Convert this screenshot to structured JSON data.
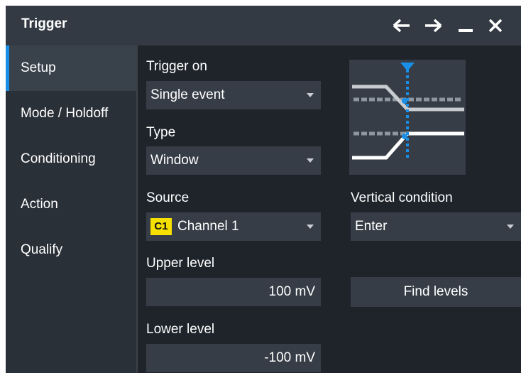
{
  "window": {
    "title": "Trigger",
    "icons": [
      "arrow-left-icon",
      "arrow-right-icon",
      "minimize-icon",
      "close-icon"
    ]
  },
  "sidebar": {
    "items": [
      {
        "label": "Setup",
        "active": true
      },
      {
        "label": "Mode / Holdoff",
        "active": false
      },
      {
        "label": "Conditioning",
        "active": false
      },
      {
        "label": "Action",
        "active": false
      },
      {
        "label": "Qualify",
        "active": false
      }
    ]
  },
  "form": {
    "trigger_on": {
      "label": "Trigger on",
      "value": "Single event"
    },
    "type": {
      "label": "Type",
      "value": "Window"
    },
    "source": {
      "label": "Source",
      "badge": "C1",
      "value": "Channel 1"
    },
    "vertical_condition": {
      "label": "Vertical condition",
      "value": "Enter"
    },
    "upper_level": {
      "label": "Upper level",
      "value": "100 mV"
    },
    "lower_level": {
      "label": "Lower level",
      "value": "-100 mV"
    },
    "find_levels_label": "Find levels"
  },
  "colors": {
    "accent": "#1a8fe8",
    "badge": "#f5e000",
    "panel": "#1f242b",
    "sidebar": "#2a3038",
    "field": "#363d46"
  }
}
